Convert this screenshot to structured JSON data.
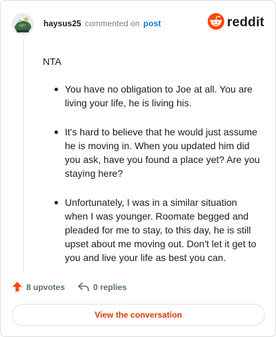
{
  "header": {
    "username": "haysus25",
    "verb": "commented on",
    "post_link": "post",
    "brand_wordmark": "reddit"
  },
  "comment": {
    "first_line": "NTA",
    "bullets": [
      "You have no obligation to Joe at all. You are living your life, he is living his.",
      "It's hard to believe that he would just assume he is moving in. When you updated him did you ask, have you found a place yet? Are you staying here?",
      "Unfortunately, I was in a similar situation when I was younger. Roomate begged and pleaded for me to stay, to this day, he is still upset about me moving out. Don't let it get to you and live your life as best you can."
    ]
  },
  "actions": {
    "upvotes_label": "8 upvotes",
    "replies_label": "0 replies"
  },
  "cta": {
    "label": "View the conversation"
  },
  "icons": {
    "avatar": "user-avatar-icon",
    "brand": "reddit-snoo-icon",
    "upvote": "upvote-arrow-icon",
    "reply": "reply-arrow-icon"
  },
  "colors": {
    "brand_orange": "#ff4500",
    "link_blue": "#0079d3",
    "cta_text": "#d93a00",
    "action_gray": "#576f76"
  }
}
